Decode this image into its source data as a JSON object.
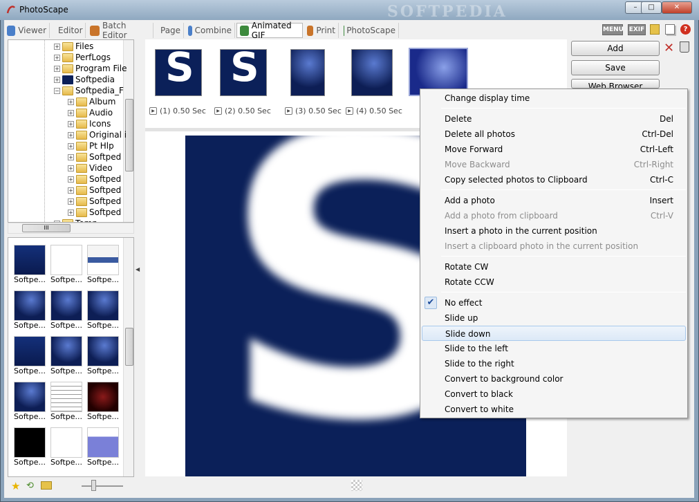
{
  "window": {
    "title": "PhotoScape",
    "brand": "SOFTPEDIA",
    "min": "–",
    "max": "□",
    "close": "✕"
  },
  "tabs": [
    {
      "label": "Viewer",
      "icon": "viewer-icon",
      "color": "#4a7fc9"
    },
    {
      "label": "Editor",
      "icon": "editor-icon",
      "color": "#3d8a3d"
    },
    {
      "label": "Batch Editor",
      "icon": "batch-editor-icon",
      "color": "#c9742a"
    },
    {
      "label": "Page",
      "icon": "page-icon",
      "color": "#b03a3a"
    },
    {
      "label": "Combine",
      "icon": "combine-icon",
      "color": "#4a7fc9"
    },
    {
      "label": "Animated GIF",
      "icon": "animated-gif-icon",
      "color": "#3d8a3d"
    },
    {
      "label": "Print",
      "icon": "print-icon",
      "color": "#c9742a"
    },
    {
      "label": "PhotoScape",
      "icon": "photoscape-icon",
      "color": "#3d8a3d"
    }
  ],
  "active_tab": "Animated GIF",
  "toolbar_right": {
    "menu": "MENU",
    "exif": "EXIF"
  },
  "tree": [
    {
      "label": "Files",
      "level": 1
    },
    {
      "label": "PerfLogs",
      "level": 1
    },
    {
      "label": "Program File",
      "level": 1
    },
    {
      "label": "Softpedia",
      "level": 1,
      "special": true
    },
    {
      "label": "Softpedia_F",
      "level": 1,
      "expanded": true
    },
    {
      "label": "Album",
      "level": 2
    },
    {
      "label": "Audio",
      "level": 2
    },
    {
      "label": "Icons",
      "level": 2
    },
    {
      "label": "Original i",
      "level": 2
    },
    {
      "label": "Pt Hlp",
      "level": 2
    },
    {
      "label": "Softped",
      "level": 2
    },
    {
      "label": "Video",
      "level": 2
    },
    {
      "label": "Softped",
      "level": 2
    },
    {
      "label": "Softped",
      "level": 2
    },
    {
      "label": "Softped",
      "level": 2
    },
    {
      "label": "Softped",
      "level": 2
    },
    {
      "label": "Temp",
      "level": 1
    }
  ],
  "thumbs": [
    {
      "label": "Softpe...",
      "style": "navy"
    },
    {
      "label": "Softpe...",
      "style": "white"
    },
    {
      "label": "Softpe...",
      "style": "web"
    },
    {
      "label": "Softpe...",
      "style": "navy2"
    },
    {
      "label": "Softpe...",
      "style": "navy2"
    },
    {
      "label": "Softpe...",
      "style": "navy2"
    },
    {
      "label": "Softpe...",
      "style": "navy"
    },
    {
      "label": "Softpe...",
      "style": "navy2"
    },
    {
      "label": "Softpe...",
      "style": "navy2"
    },
    {
      "label": "Softpe...",
      "style": "navy2"
    },
    {
      "label": "Softpe...",
      "style": "text"
    },
    {
      "label": "Softpe...",
      "style": "red"
    },
    {
      "label": "Softpe...",
      "style": "black"
    },
    {
      "label": "Softpe...",
      "style": "white"
    },
    {
      "label": "Softpe...",
      "style": "purple"
    }
  ],
  "frames": [
    {
      "label": "(1) 0.50 Sec",
      "letter": "S"
    },
    {
      "label": "(2) 0.50 Sec",
      "letter": "S"
    },
    {
      "label": "(3) 0.50 Sec",
      "letter": ""
    },
    {
      "label": "(4) 0.50 Sec",
      "letter": ""
    },
    {
      "label": "",
      "letter": ""
    }
  ],
  "preview_letter": "S",
  "buttons": {
    "add": "Add",
    "save": "Save",
    "web_preview": "Web Browser Preview"
  },
  "menu": {
    "groups": [
      [
        {
          "label": "Change display time",
          "shortcut": ""
        }
      ],
      [
        {
          "label": "Delete",
          "shortcut": "Del"
        },
        {
          "label": "Delete all photos",
          "shortcut": "Ctrl-Del"
        },
        {
          "label": "Move Forward",
          "shortcut": "Ctrl-Left"
        },
        {
          "label": "Move Backward",
          "shortcut": "Ctrl-Right",
          "disabled": true
        },
        {
          "label": "Copy selected photos to Clipboard",
          "shortcut": "Ctrl-C"
        }
      ],
      [
        {
          "label": "Add a photo",
          "shortcut": "Insert"
        },
        {
          "label": "Add a photo from clipboard",
          "shortcut": "Ctrl-V",
          "disabled": true
        },
        {
          "label": "Insert a photo in the current position",
          "shortcut": ""
        },
        {
          "label": "Insert a clipboard photo in the current position",
          "shortcut": "",
          "disabled": true
        }
      ],
      [
        {
          "label": "Rotate CW",
          "shortcut": ""
        },
        {
          "label": "Rotate CCW",
          "shortcut": ""
        }
      ],
      [
        {
          "label": "No effect",
          "shortcut": "",
          "checked": true
        },
        {
          "label": "Slide up",
          "shortcut": ""
        },
        {
          "label": "Slide down",
          "shortcut": "",
          "highlighted": true
        },
        {
          "label": "Slide to the left",
          "shortcut": ""
        },
        {
          "label": "Slide to the right",
          "shortcut": ""
        },
        {
          "label": "Convert to background color",
          "shortcut": ""
        },
        {
          "label": "Convert to black",
          "shortcut": ""
        },
        {
          "label": "Convert to white",
          "shortcut": ""
        }
      ]
    ],
    "check_glyph": "✔"
  },
  "scroll_glyph": "III",
  "colors": {
    "accent": "#1b4a9a",
    "navy": "#0b2059"
  }
}
